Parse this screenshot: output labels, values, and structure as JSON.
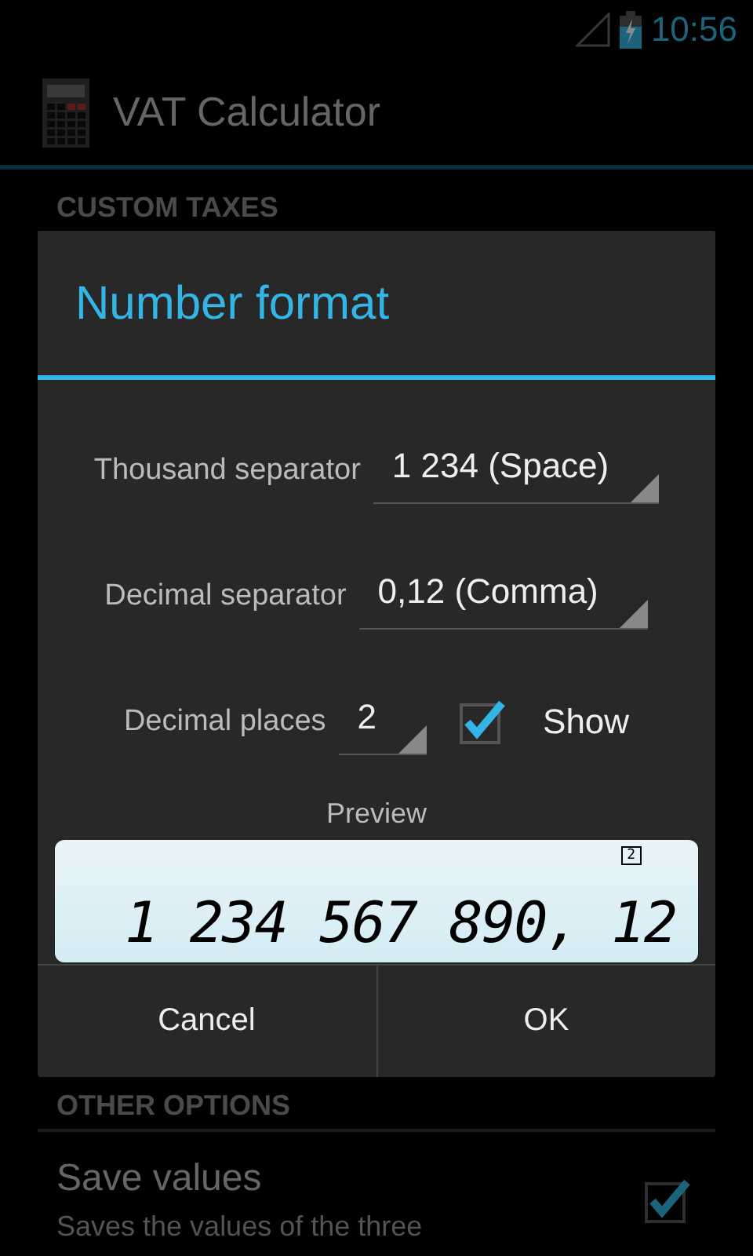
{
  "status_bar": {
    "time": "10:56"
  },
  "action_bar": {
    "title": "VAT Calculator"
  },
  "page": {
    "section_custom": "CUSTOM TAXES",
    "section_other": "OTHER OPTIONS",
    "settings": [
      {
        "title": "Save values",
        "summary": "Saves the values of the three",
        "checked": true
      }
    ]
  },
  "dialog": {
    "title": "Number format",
    "fields": [
      {
        "kind": "spinner",
        "label": "Thousand separator",
        "value": "1 234 (Space)"
      },
      {
        "kind": "spinner",
        "label": "Decimal separator",
        "value": "0,12 (Comma)"
      },
      {
        "kind": "spinner_check",
        "label": "Decimal places",
        "value": "2",
        "check_label": "Show",
        "checked": true
      }
    ],
    "preview_label": "Preview",
    "preview": {
      "indicator": "2",
      "display": "1 234 567 890, 12"
    },
    "buttons": [
      "Cancel",
      "OK"
    ]
  }
}
